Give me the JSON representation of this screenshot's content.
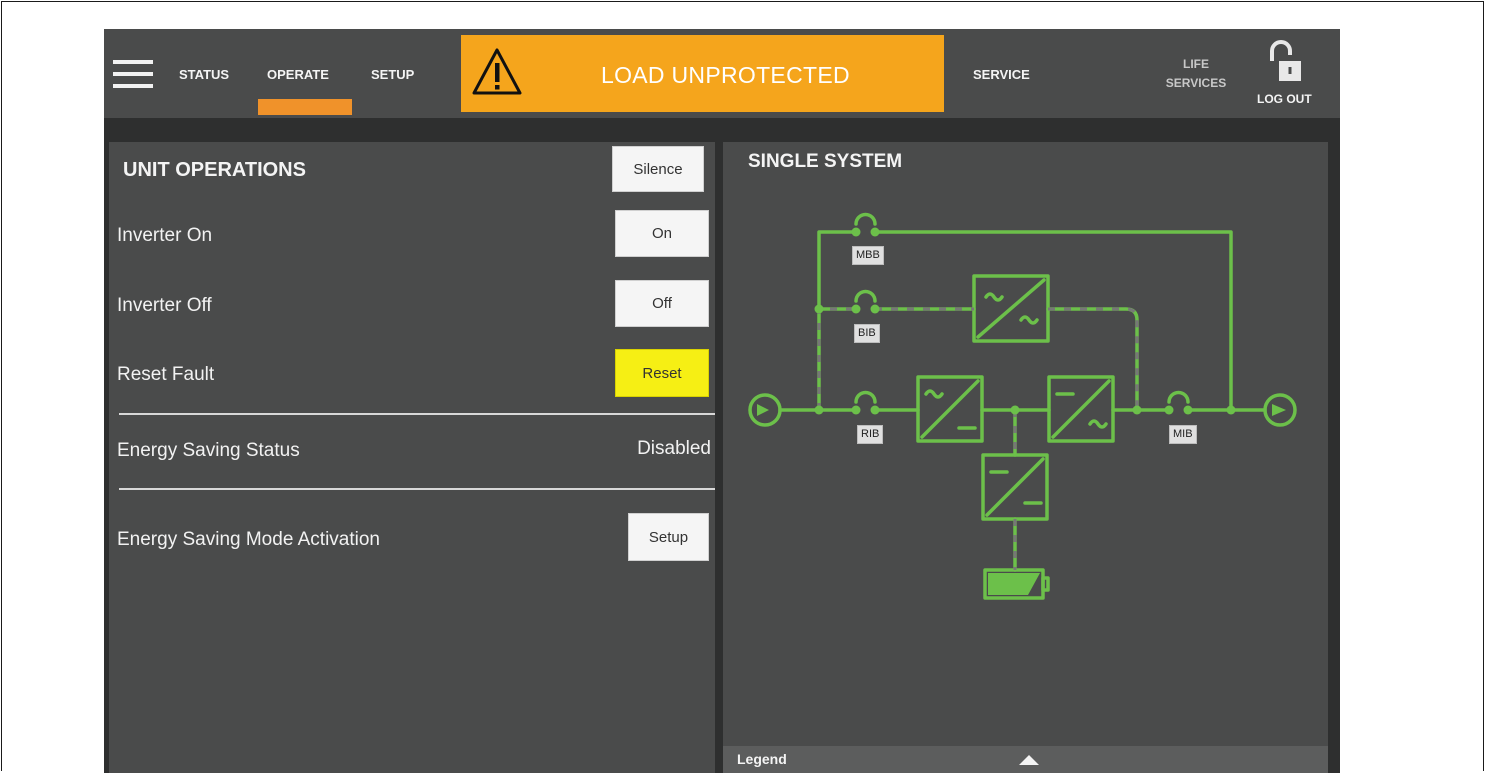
{
  "header": {
    "nav": {
      "status": "STATUS",
      "operate": "OPERATE",
      "setup": "SETUP",
      "service": "SERVICE",
      "life_services": "LIFE SERVICES",
      "logout": "LOG OUT"
    },
    "alarm_text": "LOAD UNPROTECTED",
    "active_tab": "OPERATE"
  },
  "unit_operations": {
    "title": "UNIT OPERATIONS",
    "silence_button": "Silence",
    "rows": {
      "inverter_on": {
        "label": "Inverter On",
        "button": "On"
      },
      "inverter_off": {
        "label": "Inverter Off",
        "button": "Off"
      },
      "reset_fault": {
        "label": "Reset Fault",
        "button": "Reset"
      },
      "energy_saving_status": {
        "label": "Energy Saving Status",
        "value": "Disabled"
      },
      "energy_saving_mode": {
        "label": "Energy Saving Mode Activation",
        "button": "Setup"
      }
    }
  },
  "single_system": {
    "title": "SINGLE SYSTEM",
    "tags": {
      "mbb": "MBB",
      "bib": "BIB",
      "rib": "RIB",
      "mib": "MIB"
    },
    "legend_label": "Legend"
  },
  "colors": {
    "alarm": "#f5a51c",
    "active_tab": "#f0922a",
    "power_flow": "#6cc04a",
    "reset_button": "#f6ef14"
  }
}
